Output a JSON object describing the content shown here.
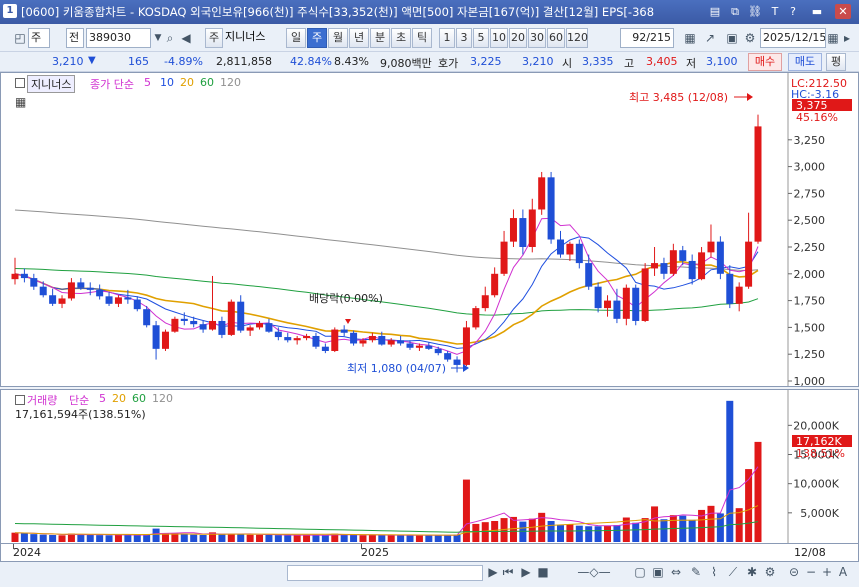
{
  "title_bar": {
    "window_number": "1",
    "title": "[0600] 키움종합차트 - KOSDAQ 외국인보유[966(천)] 주식수[33,352(천)] 액면[500] 자본금[167(억)] 결산[12월] EPS[-368",
    "buttons": [
      "window-list-icon",
      "copy-icon",
      "link-icon",
      "text-icon",
      "help-icon",
      "minimize-icon",
      "close-icon"
    ]
  },
  "toolbar": {
    "period_unit": "주",
    "prev_label": "전",
    "stock_code": "389030",
    "stock_tag": "주",
    "stock_name": "지니너스",
    "period_tabs": [
      "일",
      "주",
      "월",
      "년",
      "분",
      "초",
      "틱"
    ],
    "active_tab": "주",
    "interval_buttons": [
      "1",
      "3",
      "5",
      "10",
      "20",
      "30",
      "60",
      "120"
    ],
    "count_display": "92/215",
    "date_value": "2025/12/15"
  },
  "quote": {
    "price": "3,210",
    "change": "165",
    "change_pct": "-4.89%",
    "volume": "2,811,858",
    "ratio1": "42.84%",
    "ratio2": "8.43%",
    "amount": "9,080백만",
    "bid_label": "호가",
    "bid1": "3,225",
    "bid2": "3,210",
    "open_label": "시",
    "open": "3,335",
    "high_label": "고",
    "high": "3,405",
    "low_label": "저",
    "low": "3,100",
    "buy_label": "매수",
    "sell_label": "매도",
    "eval_label": "평"
  },
  "main_chart": {
    "legend_name": "지니너스",
    "ma_legend": "종가 단순",
    "ma_periods": [
      "5",
      "10",
      "20",
      "60",
      "120"
    ],
    "ma_colors": [
      "#d030d0",
      "#2050e0",
      "#e0a000",
      "#20a040",
      "#909090"
    ],
    "lc_label": "LC:212.50",
    "hc_label": "HC:-3.16",
    "price_tag": "3,375",
    "pct_tag": "45.16%",
    "annotation_high": "최고 3,485 (12/08)",
    "annotation_low": "최저 1,080 (04/07)",
    "annotation_dividend": "배당락(0.00%)",
    "y_ticks": [
      "3,250",
      "3,000",
      "2,750",
      "2,500",
      "2,250",
      "2,000",
      "1,750",
      "1,500",
      "1,250",
      "1,000"
    ]
  },
  "volume_chart": {
    "legend_name": "거래량",
    "ma_legend": "단순",
    "ma_periods": [
      "5",
      "20",
      "60",
      "120"
    ],
    "ma_colors": [
      "#d030d0",
      "#e0a000",
      "#20a040",
      "#909090"
    ],
    "current_volume": "17,161,594주(138.51%)",
    "vol_tag": "17,162K",
    "pct_tag": "138.51%",
    "y_ticks": [
      "20,000K",
      "15,000K",
      "10,000K",
      "5,000K"
    ]
  },
  "x_axis": {
    "labels": [
      "2024",
      "2025"
    ],
    "right_label": "12/08"
  },
  "colors": {
    "up": "#e01818",
    "down": "#1f4fd6",
    "accent": "#3b6ed0",
    "titlebar": "#3b5aa5"
  },
  "chart_data": {
    "type": "candlestick",
    "title": "",
    "period": "weekly",
    "candles_ohlc": [
      [
        1950,
        2150,
        1900,
        2000
      ],
      [
        2000,
        2050,
        1920,
        1960
      ],
      [
        1960,
        2000,
        1850,
        1880
      ],
      [
        1880,
        1930,
        1780,
        1800
      ],
      [
        1800,
        1860,
        1700,
        1720
      ],
      [
        1720,
        1800,
        1680,
        1770
      ],
      [
        1770,
        1960,
        1750,
        1920
      ],
      [
        1920,
        1960,
        1850,
        1870
      ],
      [
        1870,
        1920,
        1800,
        1850
      ],
      [
        1850,
        1900,
        1760,
        1790
      ],
      [
        1790,
        1830,
        1700,
        1720
      ],
      [
        1720,
        1800,
        1690,
        1780
      ],
      [
        1780,
        1850,
        1720,
        1760
      ],
      [
        1760,
        1790,
        1650,
        1670
      ],
      [
        1670,
        1700,
        1500,
        1520
      ],
      [
        1520,
        1560,
        1200,
        1300
      ],
      [
        1300,
        1480,
        1280,
        1460
      ],
      [
        1460,
        1600,
        1450,
        1580
      ],
      [
        1580,
        1640,
        1520,
        1560
      ],
      [
        1560,
        1600,
        1500,
        1530
      ],
      [
        1530,
        1560,
        1450,
        1480
      ],
      [
        1480,
        1980,
        1470,
        1560
      ],
      [
        1560,
        1600,
        1400,
        1430
      ],
      [
        1430,
        1760,
        1420,
        1740
      ],
      [
        1740,
        1800,
        1450,
        1470
      ],
      [
        1470,
        1520,
        1420,
        1500
      ],
      [
        1500,
        1560,
        1480,
        1540
      ],
      [
        1540,
        1580,
        1450,
        1460
      ],
      [
        1460,
        1500,
        1380,
        1410
      ],
      [
        1410,
        1450,
        1360,
        1380
      ],
      [
        1380,
        1420,
        1340,
        1400
      ],
      [
        1400,
        1440,
        1380,
        1420
      ],
      [
        1420,
        1450,
        1300,
        1320
      ],
      [
        1320,
        1350,
        1260,
        1280
      ],
      [
        1280,
        1500,
        1270,
        1480
      ],
      [
        1480,
        1520,
        1420,
        1450
      ],
      [
        1450,
        1470,
        1330,
        1350
      ],
      [
        1350,
        1400,
        1320,
        1380
      ],
      [
        1380,
        1450,
        1360,
        1420
      ],
      [
        1420,
        1460,
        1330,
        1340
      ],
      [
        1340,
        1400,
        1320,
        1380
      ],
      [
        1380,
        1420,
        1330,
        1350
      ],
      [
        1350,
        1380,
        1290,
        1310
      ],
      [
        1310,
        1350,
        1280,
        1330
      ],
      [
        1330,
        1360,
        1290,
        1300
      ],
      [
        1300,
        1320,
        1240,
        1260
      ],
      [
        1260,
        1280,
        1180,
        1200
      ],
      [
        1200,
        1230,
        1080,
        1150
      ],
      [
        1150,
        1560,
        1140,
        1500
      ],
      [
        1500,
        1700,
        1480,
        1680
      ],
      [
        1680,
        1880,
        1650,
        1800
      ],
      [
        1800,
        2060,
        1780,
        2000
      ],
      [
        2000,
        2400,
        1980,
        2300
      ],
      [
        2300,
        2600,
        2250,
        2520
      ],
      [
        2520,
        2600,
        2180,
        2250
      ],
      [
        2250,
        2700,
        2200,
        2600
      ],
      [
        2600,
        2950,
        2550,
        2900
      ],
      [
        2900,
        2950,
        2280,
        2320
      ],
      [
        2320,
        2400,
        2150,
        2180
      ],
      [
        2180,
        2300,
        2120,
        2280
      ],
      [
        2280,
        2320,
        2050,
        2100
      ],
      [
        2100,
        2180,
        1850,
        1880
      ],
      [
        1880,
        1920,
        1640,
        1680
      ],
      [
        1680,
        1800,
        1600,
        1750
      ],
      [
        1750,
        1860,
        1540,
        1580
      ],
      [
        1580,
        1900,
        1520,
        1870
      ],
      [
        1870,
        1900,
        1520,
        1560
      ],
      [
        1560,
        2100,
        1550,
        2050
      ],
      [
        2050,
        2250,
        1980,
        2100
      ],
      [
        2100,
        2150,
        1950,
        2000
      ],
      [
        2000,
        2280,
        1980,
        2220
      ],
      [
        2220,
        2260,
        2080,
        2120
      ],
      [
        2120,
        2180,
        1900,
        1950
      ],
      [
        1950,
        2250,
        1940,
        2200
      ],
      [
        2200,
        2460,
        2150,
        2300
      ],
      [
        2300,
        2350,
        1950,
        2000
      ],
      [
        2000,
        2080,
        1680,
        1720
      ],
      [
        1720,
        1920,
        1650,
        1880
      ],
      [
        1880,
        2570,
        1860,
        2300
      ],
      [
        2300,
        3485,
        2280,
        3375
      ]
    ],
    "volume_k": [
      1600,
      1500,
      1350,
      1250,
      1200,
      1150,
      1450,
      1280,
      1250,
      1180,
      1150,
      1260,
      1220,
      1180,
      1200,
      2300,
      1500,
      1460,
      1430,
      1250,
      1200,
      1650,
      1280,
      1400,
      1350,
      1250,
      1230,
      1200,
      1180,
      1150,
      1170,
      1200,
      1180,
      1150,
      1420,
      1250,
      1200,
      1160,
      1230,
      1180,
      1170,
      1160,
      1120,
      1150,
      1130,
      1150,
      1150,
      1280,
      10700,
      3100,
      3400,
      3600,
      4100,
      4300,
      3500,
      4000,
      5000,
      3600,
      2900,
      3000,
      2800,
      2700,
      2700,
      2800,
      2900,
      4200,
      3300,
      4100,
      6100,
      3900,
      4600,
      4500,
      3800,
      5500,
      6200,
      4900,
      24200,
      5800,
      12500,
      17162
    ],
    "y_range": [
      1000,
      3500
    ],
    "volume_range_k": [
      0,
      24000
    ],
    "x_start_label": "2024",
    "x_mid_label": "2025",
    "x_end_label": "12/08"
  }
}
